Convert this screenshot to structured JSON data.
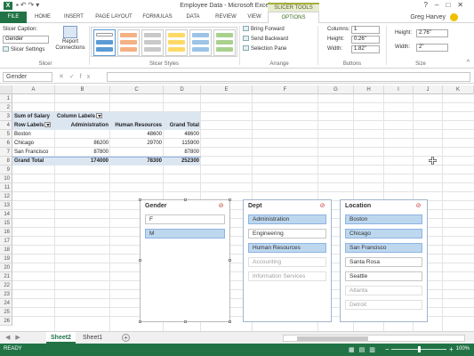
{
  "window": {
    "title": "Employee Data - Microsoft Excel Preview",
    "context_tab_group": "SLICER TOOLS",
    "user": "Greg Harvey"
  },
  "ribbon_tabs": [
    "FILE",
    "HOME",
    "INSERT",
    "PAGE LAYOUT",
    "FORMULAS",
    "DATA",
    "REVIEW",
    "VIEW",
    "OPTIONS"
  ],
  "ribbon": {
    "slicer_group": {
      "caption_label": "Slicer Caption:",
      "caption_value": "Gender",
      "settings_label": "Slicer Settings",
      "report_connections_label": "Report Connections",
      "group_label": "Slicer"
    },
    "styles_group": {
      "group_label": "Slicer Styles"
    },
    "arrange_group": {
      "bring_forward": "Bring Forward",
      "send_backward": "Send Backward",
      "selection_pane": "Selection Pane",
      "group_label": "Arrange"
    },
    "buttons_group": {
      "columns_label": "Columns:",
      "columns_value": "1",
      "height_label": "Height:",
      "height_value": "0.26\"",
      "width_label": "Width:",
      "width_value": "1.82\"",
      "group_label": "Buttons"
    },
    "size_group": {
      "height_label": "Height:",
      "height_value": "2.76\"",
      "width_label": "Width:",
      "width_value": "2\"",
      "group_label": "Size"
    }
  },
  "formula_bar": {
    "name_box": "Gender",
    "content": ""
  },
  "columns": [
    "A",
    "B",
    "C",
    "D",
    "E",
    "F",
    "G",
    "H",
    "I",
    "J",
    "K"
  ],
  "rows": [
    "1",
    "2",
    "3",
    "4",
    "5",
    "6",
    "7",
    "8",
    "9",
    "10",
    "11",
    "12",
    "13",
    "14",
    "15",
    "16",
    "17",
    "18",
    "19",
    "20",
    "21",
    "22",
    "23",
    "24",
    "25",
    "26"
  ],
  "pivot": {
    "value_label": "Sum of Salary",
    "col_labels": "Column Labels",
    "row_labels": "Row Labels",
    "headers": [
      "Administration",
      "Human Resources",
      "Grand Total"
    ],
    "rows": [
      {
        "label": "Boston",
        "admin": "",
        "hr": "48600",
        "total": "48600"
      },
      {
        "label": "Chicago",
        "admin": "86200",
        "hr": "29700",
        "total": "115900"
      },
      {
        "label": "San Francisco",
        "admin": "87800",
        "hr": "",
        "total": "87800"
      }
    ],
    "grand_total": {
      "label": "Grand Total",
      "admin": "174000",
      "hr": "78300",
      "total": "252300"
    }
  },
  "slicers": {
    "gender": {
      "title": "Gender",
      "items": [
        {
          "label": "F",
          "state": "normal"
        },
        {
          "label": "M",
          "state": "selected"
        }
      ]
    },
    "dept": {
      "title": "Dept",
      "items": [
        {
          "label": "Administration",
          "state": "selected"
        },
        {
          "label": "Engineering",
          "state": "normal"
        },
        {
          "label": "Human Resources",
          "state": "selected"
        },
        {
          "label": "Accounting",
          "state": "dim"
        },
        {
          "label": "Information Services",
          "state": "dim"
        }
      ]
    },
    "location": {
      "title": "Location",
      "items": [
        {
          "label": "Boston",
          "state": "selected"
        },
        {
          "label": "Chicago",
          "state": "selected"
        },
        {
          "label": "San Francisco",
          "state": "selected"
        },
        {
          "label": "Santa Rosa",
          "state": "normal"
        },
        {
          "label": "Seattle",
          "state": "normal"
        },
        {
          "label": "Atlanta",
          "state": "dim"
        },
        {
          "label": "Detroit",
          "state": "dim"
        }
      ]
    }
  },
  "sheets": {
    "tabs": [
      "Sheet2",
      "Sheet1"
    ],
    "active": "Sheet2"
  },
  "status": {
    "ready": "READY",
    "zoom": "100%"
  },
  "colors": {
    "accent": "#217346",
    "slicer_selected": "#bdd7ee",
    "pivot_band": "#dce6f1"
  }
}
